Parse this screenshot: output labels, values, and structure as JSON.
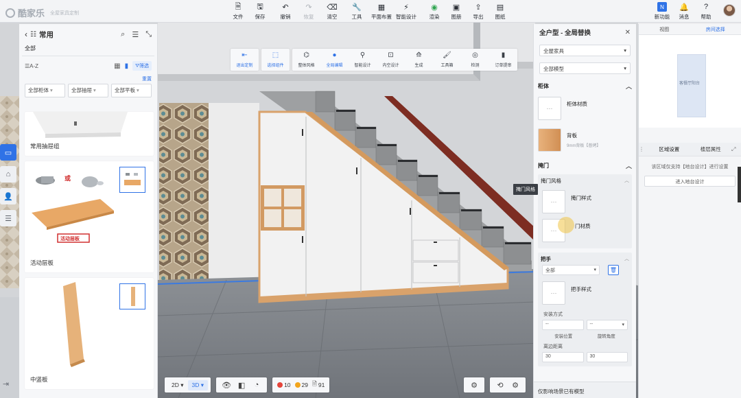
{
  "app": {
    "logo_text": "酷家乐",
    "logo_sub": "全屋家具定制"
  },
  "toolbar": {
    "main": [
      {
        "label": "文件",
        "icon": "file-icon"
      },
      {
        "label": "保存",
        "icon": "save-icon"
      },
      {
        "label": "撤销",
        "icon": "undo-icon"
      },
      {
        "label": "恢复",
        "icon": "redo-icon",
        "disabled": true
      },
      {
        "label": "清空",
        "icon": "clear-icon"
      },
      {
        "label": "工具",
        "icon": "wrench-icon"
      },
      {
        "label": "平面布置",
        "icon": "floorplan-icon"
      },
      {
        "label": "智能设计",
        "icon": "lightning-icon"
      },
      {
        "label": "渲染",
        "icon": "render-icon"
      },
      {
        "label": "图册",
        "icon": "album-icon"
      },
      {
        "label": "导出",
        "icon": "export-icon"
      },
      {
        "label": "图纸",
        "icon": "drawing-icon"
      }
    ],
    "right": [
      {
        "label": "新功能",
        "icon": "new-feature-icon"
      },
      {
        "label": "消息",
        "icon": "bell-icon"
      },
      {
        "label": "帮助",
        "icon": "help-icon"
      }
    ]
  },
  "subtoolbar": {
    "exit": {
      "label": "退出定制",
      "icon": "exit-icon"
    },
    "select": {
      "label": "选择组件",
      "icon": "select-icon"
    },
    "tools": [
      {
        "label": "整体风格",
        "icon": "style-icon"
      },
      {
        "label": "全局编辑",
        "icon": "global-edit-icon",
        "active": true
      },
      {
        "label": "智能设计",
        "icon": "smart-design-icon"
      },
      {
        "label": "内空设计",
        "icon": "inner-space-icon"
      },
      {
        "label": "生成",
        "icon": "generate-icon"
      },
      {
        "label": "工具箱",
        "icon": "toolbox-icon"
      },
      {
        "label": "检测",
        "icon": "detect-icon"
      },
      {
        "label": "订单提审",
        "icon": "order-icon"
      }
    ]
  },
  "left_panel": {
    "title": "常用",
    "all_label": "全部",
    "sort_label": "A-Z",
    "filter_label": "筛选",
    "reset_label": "重置",
    "dropdowns": [
      "全部柜体",
      "全部抽屉",
      "全部平板"
    ],
    "cards": [
      {
        "caption": "常用抽屉组"
      },
      {
        "caption": "活动层板",
        "badge": "活动层板",
        "badge_prefix": "或"
      },
      {
        "caption": "中竖板"
      }
    ]
  },
  "right_panel": {
    "title": "全户型 - 全局替换",
    "selects": [
      "全屋家具",
      "全部模型"
    ],
    "sections": {
      "cabinet": {
        "title": "柜体",
        "items": [
          {
            "name": "柜体材质"
          },
          {
            "name": "背板",
            "sub": "9mm背板【普烤】"
          }
        ]
      },
      "door": {
        "title": "掩门",
        "subtitle": "掩门风格",
        "items": [
          {
            "name": "掩门样式"
          },
          {
            "name": "门材质"
          }
        ]
      },
      "handle": {
        "title": "把手",
        "filter": "全部",
        "item": "把手样式",
        "install_label": "安装方式",
        "install_value": "--",
        "rotate_value": "--",
        "pos_label": "安装位置",
        "rotate_label": "旋转角度",
        "edge_label": "离边距离",
        "edge_values": [
          "30",
          "30"
        ]
      }
    },
    "footer": "仅影响场景已有模型"
  },
  "tooltip": "掩门风格",
  "far_right": {
    "tabs": [
      "视图",
      "房间选择"
    ],
    "room_label": "客餐厅阳台",
    "tabs2": [
      "区域设置",
      "楼层属性"
    ],
    "desc": "该区域仅支持【地台设计】进行设置",
    "enter": "进入地台设计"
  },
  "bottombar": {
    "views": [
      "2D",
      "3D"
    ],
    "errors": "10",
    "warnings": "29",
    "others": "91"
  }
}
